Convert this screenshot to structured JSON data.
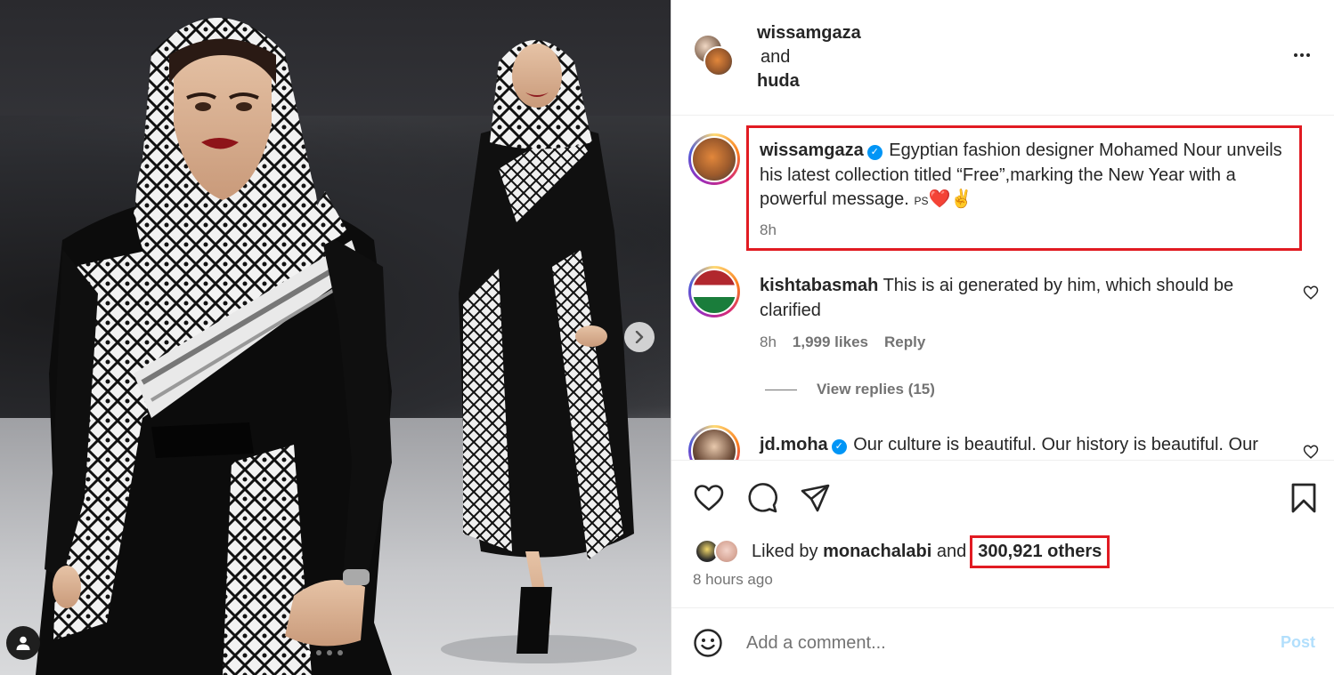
{
  "header": {
    "user1": "wissamgaza",
    "conjunction": "and",
    "user2": "huda"
  },
  "caption": {
    "username": "wissamgaza",
    "verified_icon": "verified-badge-icon",
    "text": "Egyptian fashion designer Mohamed Nour unveils his latest collection titled “Free”,marking the New Year with a powerful message.",
    "ps": "PS",
    "emoji_heart": "❤️",
    "emoji_victory": "✌️",
    "time": "8h"
  },
  "comments": [
    {
      "username": "kishtabasmah",
      "text": "This is ai generated by him, which should be clarified",
      "time": "8h",
      "likes": "1,999 likes",
      "reply": "Reply",
      "view_replies": "View replies (15)"
    },
    {
      "username": "jd.moha",
      "text": "Our culture is beautiful. Our history is beautiful. Our"
    }
  ],
  "likes": {
    "prefix": "Liked by",
    "user": "monachalabi",
    "conjunction": "and",
    "others": "300,921 others",
    "time_ago": "8 hours ago"
  },
  "comment_box": {
    "placeholder": "Add a comment...",
    "post_label": "Post"
  },
  "carousel": {
    "current_index": 1,
    "total": 4
  },
  "colors": {
    "highlight_border": "#e11b22",
    "verified": "#0095f6",
    "post_disabled": "#b2dffc"
  }
}
